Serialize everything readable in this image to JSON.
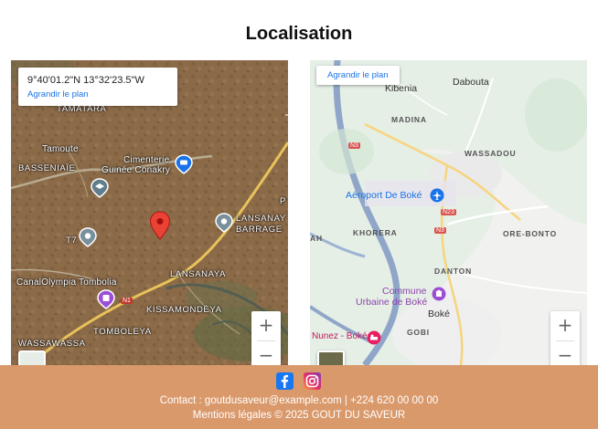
{
  "page": {
    "title": "Localisation"
  },
  "map_left": {
    "coordinates": "9°40'01.2\"N 13°32'23.5\"W",
    "enlarge_label": "Agrandir le plan",
    "zoom_in": "+",
    "zoom_out": "−",
    "labels": {
      "tamatara": "TAMATARA",
      "tamoute": "Tamoute",
      "basseniaie": "BASSENIAÏE",
      "cimenterie": "Cimenterie",
      "guinee_conakry": "Guinée Conakry",
      "lansanay_barrage_1": "LANSANAY",
      "lansanay_barrage_2": "BARRAGE",
      "t7": "T7",
      "lansanaya": "LANSANAYA",
      "canal_olympia": "CanalOlympia Tombolia",
      "kissamondeya": "KISSAMONDÈYA",
      "tomboleya": "TOMBOLEYA",
      "wassawassa": "WASSAWASSA",
      "n1": "N1",
      "p": "P"
    }
  },
  "map_right": {
    "enlarge_label": "Agrandir le plan",
    "zoom_in": "+",
    "zoom_out": "−",
    "labels": {
      "kibenia": "Kibenia",
      "dabouta": "Dabouta",
      "madina": "MADINA",
      "wassadou": "WASSADOU",
      "n3_top": "N3",
      "aeroport": "Aéroport De Boké",
      "n23": "N23",
      "khorera": "KHORERA",
      "n3_mid": "N3",
      "ore_bonto": "ORE-BONTO",
      "ah": "AH",
      "danton": "DANTON",
      "commune_1": "Commune",
      "commune_2": "Urbaine de Boké",
      "boke": "Boké",
      "nunez": "Nunez - Boké",
      "gobi": "GOBI"
    }
  },
  "footer": {
    "social": {
      "facebook": "facebook-icon",
      "instagram": "instagram-icon"
    },
    "contact_line": "Contact : goutdusaveur@example.com | +224 620 00 00 00",
    "legal_line": "Mentions légales © 2025 GOUT DU SAVEUR"
  },
  "colors": {
    "footer_bg": "#d9996b",
    "link_blue": "#1a73e8",
    "pin_red": "#ea4335"
  }
}
